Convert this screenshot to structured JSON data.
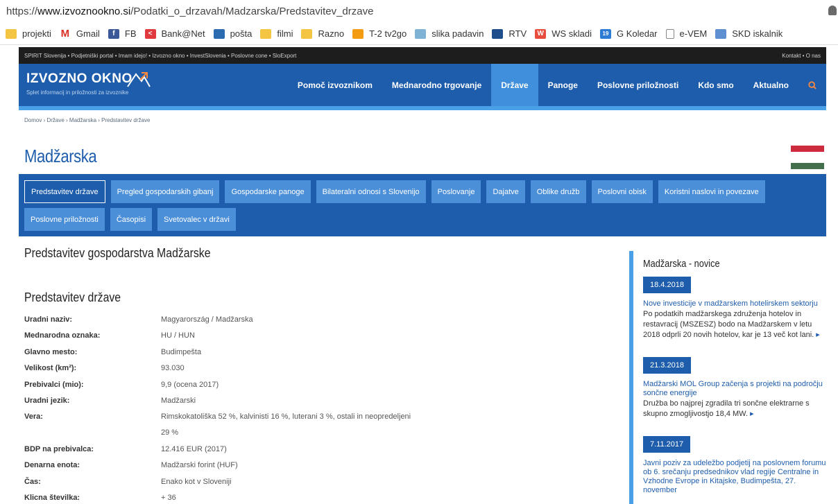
{
  "browser": {
    "url_prefix": "https://",
    "url_host": "www.izvoznookno.si",
    "url_path": "/Podatki_o_drzavah/Madzarska/Predstavitev_drzave",
    "bookmarks": [
      {
        "label": "projekti",
        "icon": "folder-icon"
      },
      {
        "label": "Gmail",
        "icon": "gmail-icon"
      },
      {
        "label": "FB",
        "icon": "facebook-icon"
      },
      {
        "label": "Bank@Net",
        "icon": "bank-icon"
      },
      {
        "label": "pošta",
        "icon": "mail-icon"
      },
      {
        "label": "filmi",
        "icon": "folder-icon"
      },
      {
        "label": "Razno",
        "icon": "folder-icon"
      },
      {
        "label": "T-2 tv2go",
        "icon": "tv-icon"
      },
      {
        "label": "slika padavin",
        "icon": "weather-icon"
      },
      {
        "label": "RTV",
        "icon": "rtv-icon"
      },
      {
        "label": "WS skladi",
        "icon": "ws-icon"
      },
      {
        "label": "G Koledar",
        "icon": "calendar-icon"
      },
      {
        "label": "e-VEM",
        "icon": "document-icon"
      },
      {
        "label": "SKD iskalnik",
        "icon": "skd-icon"
      }
    ]
  },
  "topstrip": {
    "links": "SPIRIT Slovenija  •  Podjetniški portal  •  Imam idejo!  •  Izvozno okno  •  InvestSlovenia  •  Poslovne cone  •  SloExport",
    "right": "Kontakt  •  O nas"
  },
  "logo": {
    "name": "IZVOZNO OKNO",
    "tagline": "Splet informacij in priložnosti za izvoznike"
  },
  "nav": [
    {
      "label": "Pomoč izvoznikom",
      "active": false
    },
    {
      "label": "Mednarodno trgovanje",
      "active": false
    },
    {
      "label": "Države",
      "active": true
    },
    {
      "label": "Panoge",
      "active": false
    },
    {
      "label": "Poslovne priložnosti",
      "active": false
    },
    {
      "label": "Kdo smo",
      "active": false
    },
    {
      "label": "Aktualno",
      "active": false
    }
  ],
  "breadcrumb": "Domov › Države › Madžarska › Predstavitev države",
  "page_title": "Madžarska",
  "flag_colors": [
    "#cd2a3e",
    "#ffffff",
    "#436f4d"
  ],
  "tabs": [
    {
      "label": "Predstavitev države",
      "active": true
    },
    {
      "label": "Pregled gospodarskih gibanj",
      "active": false
    },
    {
      "label": "Gospodarske panoge",
      "active": false
    },
    {
      "label": "Bilateralni odnosi s Slovenijo",
      "active": false
    },
    {
      "label": "Poslovanje",
      "active": false
    },
    {
      "label": "Dajatve",
      "active": false
    },
    {
      "label": "Oblike družb",
      "active": false
    },
    {
      "label": "Poslovni obisk",
      "active": false
    },
    {
      "label": "Koristni naslovi in povezave",
      "active": false
    },
    {
      "label": "Poslovne priložnosti",
      "active": false
    },
    {
      "label": "Časopisi",
      "active": false
    },
    {
      "label": "Svetovalec v državi",
      "active": false
    }
  ],
  "content": {
    "heading": "Predstavitev gospodarstva Madžarske",
    "subheading": "Predstavitev države",
    "facts": [
      {
        "key": "Uradni naziv:",
        "value": "Magyarország / Madžarska"
      },
      {
        "key": "Mednarodna oznaka:",
        "value": "HU / HUN"
      },
      {
        "key": "Glavno mesto:",
        "value": "Budimpešta"
      },
      {
        "key": "Velikost (km²):",
        "value": "93.030"
      },
      {
        "key": "Prebivalci (mio):",
        "value": "9,9 (ocena 2017)"
      },
      {
        "key": "Uradni jezik:",
        "value": "Madžarski"
      },
      {
        "key": "Vera:",
        "value": "Rimskokatoliška 52 %, kalvinisti 16 %, luterani 3 %, ostali in neopredeljeni",
        "value2": "29 %"
      },
      {
        "key": "BDP na prebivalca:",
        "value": "12.416 EUR (2017)"
      },
      {
        "key": "Denarna enota:",
        "value": "Madžarski forint (HUF)"
      },
      {
        "key": "Čas:",
        "value": "Enako kot v Sloveniji"
      },
      {
        "key": "Klicna številka:",
        "value": "+ 36"
      }
    ]
  },
  "sidebar": {
    "title": "Madžarska - novice",
    "news": [
      {
        "date": "18.4.2018",
        "title": "Nove investicije v madžarskem hotelirskem sektorju",
        "body": "Po podatkih madžarskega združenja hotelov in restavracij (MSZESZ) bodo na Madžarskem v letu 2018 odprli 20 novih hotelov, kar je 13 več kot lani.",
        "more": "▸"
      },
      {
        "date": "21.3.2018",
        "title": "Madžarski MOL Group začenja s projekti na področju sončne energije",
        "body": "Družba bo najprej zgradila tri sončne elektrarne s skupno zmogljivostjo 18,4 MW.",
        "more": "▸"
      },
      {
        "date": "7.11.2017",
        "title": "Javni poziv za udeležbo podjetij na poslovnem forumu ob 6. srečanju predsednikov vlad regije Centralne in Vzhodne Evrope in Kitajske, Budimpešta, 27. november",
        "body": "",
        "more": ""
      }
    ]
  }
}
